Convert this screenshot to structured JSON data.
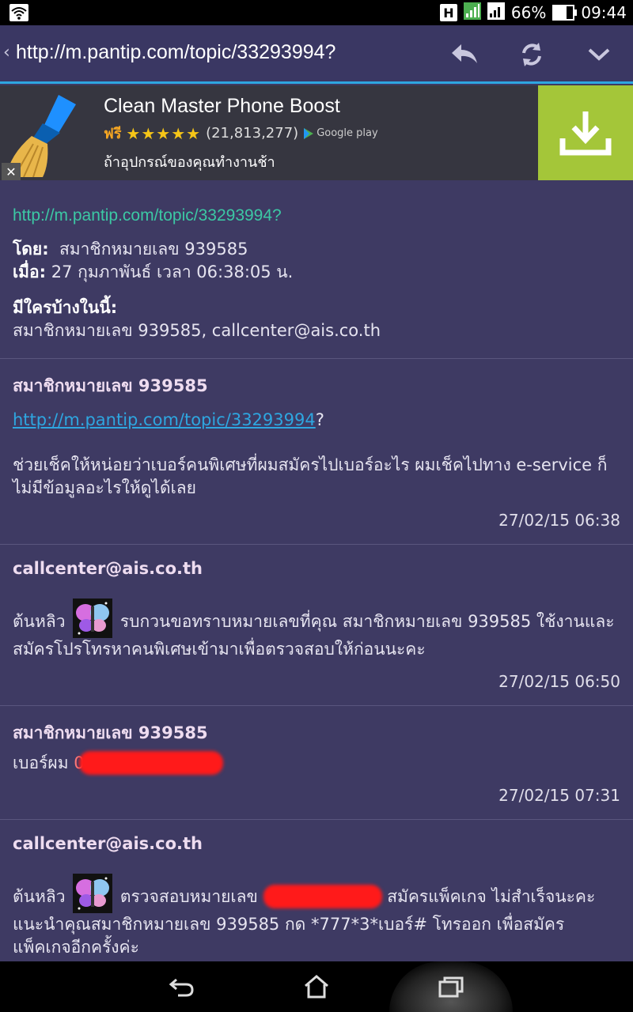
{
  "status_bar": {
    "badge": "H",
    "battery": "66%",
    "battery_level": 0.66,
    "time": "09:44"
  },
  "url_bar": {
    "url": "http://m.pantip.com/topic/33293994?"
  },
  "ad": {
    "app_name": "Clean Master Phone Boost",
    "price": "ฟรี",
    "rating": "★★★★★",
    "rating_count": "(21,813,277)",
    "store": "Google play",
    "description": "ถ้าอุปกรณ์ของคุณทำงานช้า",
    "close_label": "✕"
  },
  "topic": {
    "url": "http://m.pantip.com/topic/33293994?",
    "by_label": "โดย:",
    "by_value": "สมาชิกหมายเลข 939585",
    "when_label": "เมื่อ:",
    "when_value": "27 กุมภาพันธ์ เวลา 06:38:05 น.",
    "who_label": "มีใครบ้างในนี้:",
    "who_value": "สมาชิกหมายเลข 939585, callcenter@ais.co.th"
  },
  "posts": [
    {
      "author": "สมาชิกหมายเลข 939585",
      "link": "http://m.pantip.com/topic/33293994",
      "link_suffix": "?",
      "text": "ช่วยเช็คให้หน่อยว่าเบอร์คนพิเศษที่ผมสมัครไปเบอร์อะไร ผมเช็คไปทาง e-service ก็ไม่มีข้อมูลอะไรให้ดูได้เลย",
      "date": "27/02/15 06:38"
    },
    {
      "author": "callcenter@ais.co.th",
      "text_before": "ต้นหลิว",
      "text_after": "รบกวนขอทราบหมายเลขที่คุณ      สมาชิกหมายเลข 939585 ใช้งานและสมัครโปรโทรหาคนพิเศษเข้ามาเพื่อตรวจสอบให้ก่อนนะคะ",
      "date": "27/02/15 06:50"
    },
    {
      "author": "สมาชิกหมายเลข 939585",
      "text": "เบอร์ผม",
      "redacted_hint": "098",
      "date": "27/02/15 07:31"
    },
    {
      "author": "callcenter@ais.co.th",
      "text_before": "ต้นหลิว",
      "text_mid": "ตรวจสอบหมายเลข",
      "text_after": "สมัครแพ็คเกจ ไม่สำเร็จนะคะ แนะนำคุณสมาชิกหมายเลข 939585 กด *777*3*เบอร์# โทรออก เพื่อสมัครแพ็คเกจอีกครั้งค่ะ"
    }
  ]
}
